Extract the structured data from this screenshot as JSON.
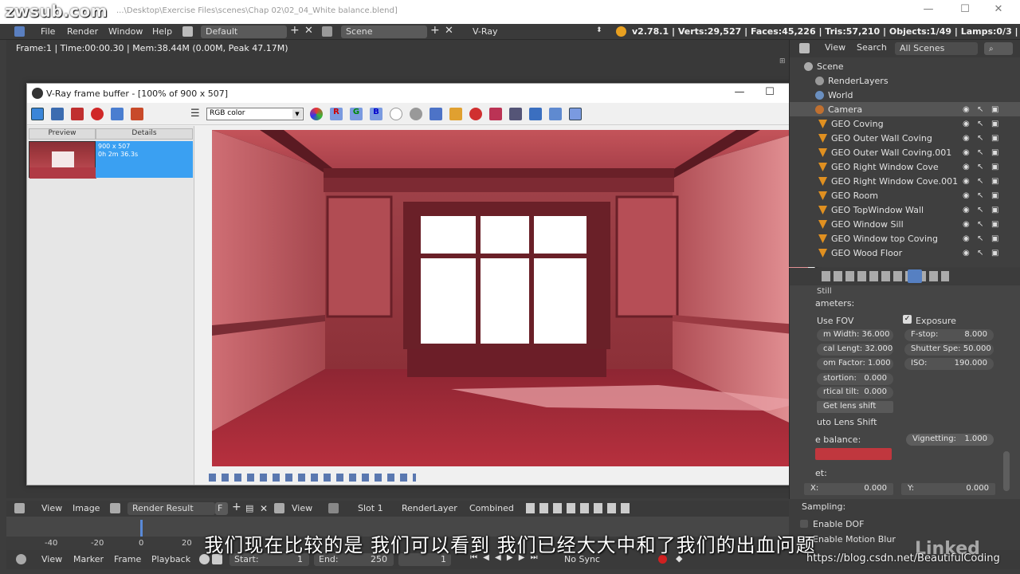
{
  "watermark": "zwsub.com",
  "os_title": "...\\Desktop\\Exercise Files\\scenes\\Chap 02\\02_04_White balance.blend]",
  "top_menu": {
    "file": "File",
    "render": "Render",
    "window": "Window",
    "help": "Help",
    "layout": "Default",
    "scene": "Scene",
    "engine": "V-Ray"
  },
  "stats": "v2.78.1 | Verts:29,527 | Faces:45,226 | Tris:57,210 | Objects:1/49 | Lamps:0/3 | Mem:38.46M | Camera",
  "frame_info": "Frame:1 | Time:00:00.30 | Mem:38.44M (0.00M, Peak 47.17M)",
  "vfb": {
    "title": "V-Ray frame buffer - [100% of 900 x 507]",
    "color_mode": "RGB color",
    "history_cols": [
      "Preview",
      "Details"
    ],
    "history_item": {
      "size": "900 x 507",
      "time": "0h 2m 36.3s"
    }
  },
  "outliner": {
    "tabs": [
      "View",
      "Search",
      "All Scenes"
    ],
    "items": [
      "Scene",
      "RenderLayers",
      "World",
      "Camera",
      "GEO Coving",
      "GEO Outer Wall Coving",
      "GEO Outer Wall Coving.001",
      "GEO Right Window Cove",
      "GEO Right Window Cove.001",
      "GEO Room",
      "GEO TopWindow Wall",
      "GEO Window Sill",
      "GEO Window top Coving",
      "GEO Wood Floor"
    ]
  },
  "properties": {
    "section_parameters": "ameters:",
    "use_fov": "Use FOV",
    "exposure": "Exposure",
    "film_width": "m Width: 36.000",
    "focal_length": "cal Lengt: 32.000",
    "zoom_factor": "om Factor: 1.000",
    "fstop": "F-stop:",
    "fstop_val": "8.000",
    "shutter": "Shutter Spe: 50.000",
    "iso": "ISO:",
    "iso_val": "190.000",
    "distortion": "stortion:",
    "distortion_val": "0.000",
    "vertical_tilt": "rtical tilt:",
    "vertical_tilt_val": "0.000",
    "get_lens_shift": "Get lens shift",
    "auto_lens_shift": "uto Lens Shift",
    "white_balance": "e balance:",
    "white_balance_color": "#c0373e",
    "vignetting": "Vignetting:",
    "vignetting_val": "1.000",
    "offset": "et:",
    "x_label": "X:",
    "x_val": "0.000",
    "y_label": "Y:",
    "y_val": "0.000",
    "sampling": "Sampling:",
    "enable_dof": "Enable DOF",
    "motion_blur": "Enable Motion Blur"
  },
  "image_header": {
    "view": "View",
    "image": "Image",
    "render_result": "Render Result",
    "f": "F",
    "view2": "View",
    "slot": "Slot 1",
    "renderlayer": "RenderLayer",
    "combined": "Combined"
  },
  "timeline": {
    "ticks": [
      "-40",
      "-20",
      "0",
      "20"
    ]
  },
  "bottom_header": {
    "view": "View",
    "marker": "Marker",
    "frame": "Frame",
    "playback": "Playback",
    "start": "Start:",
    "start_val": "1",
    "end": "End:",
    "end_val": "250",
    "current": "1",
    "sync": "No Sync"
  },
  "subtitle": "我们现在比较的是 我们可以看到 我们已经大大中和了我们的出血问题",
  "linkedin": "Linked",
  "url_mark": "https://blog.csdn.net/BeautifulCoding"
}
